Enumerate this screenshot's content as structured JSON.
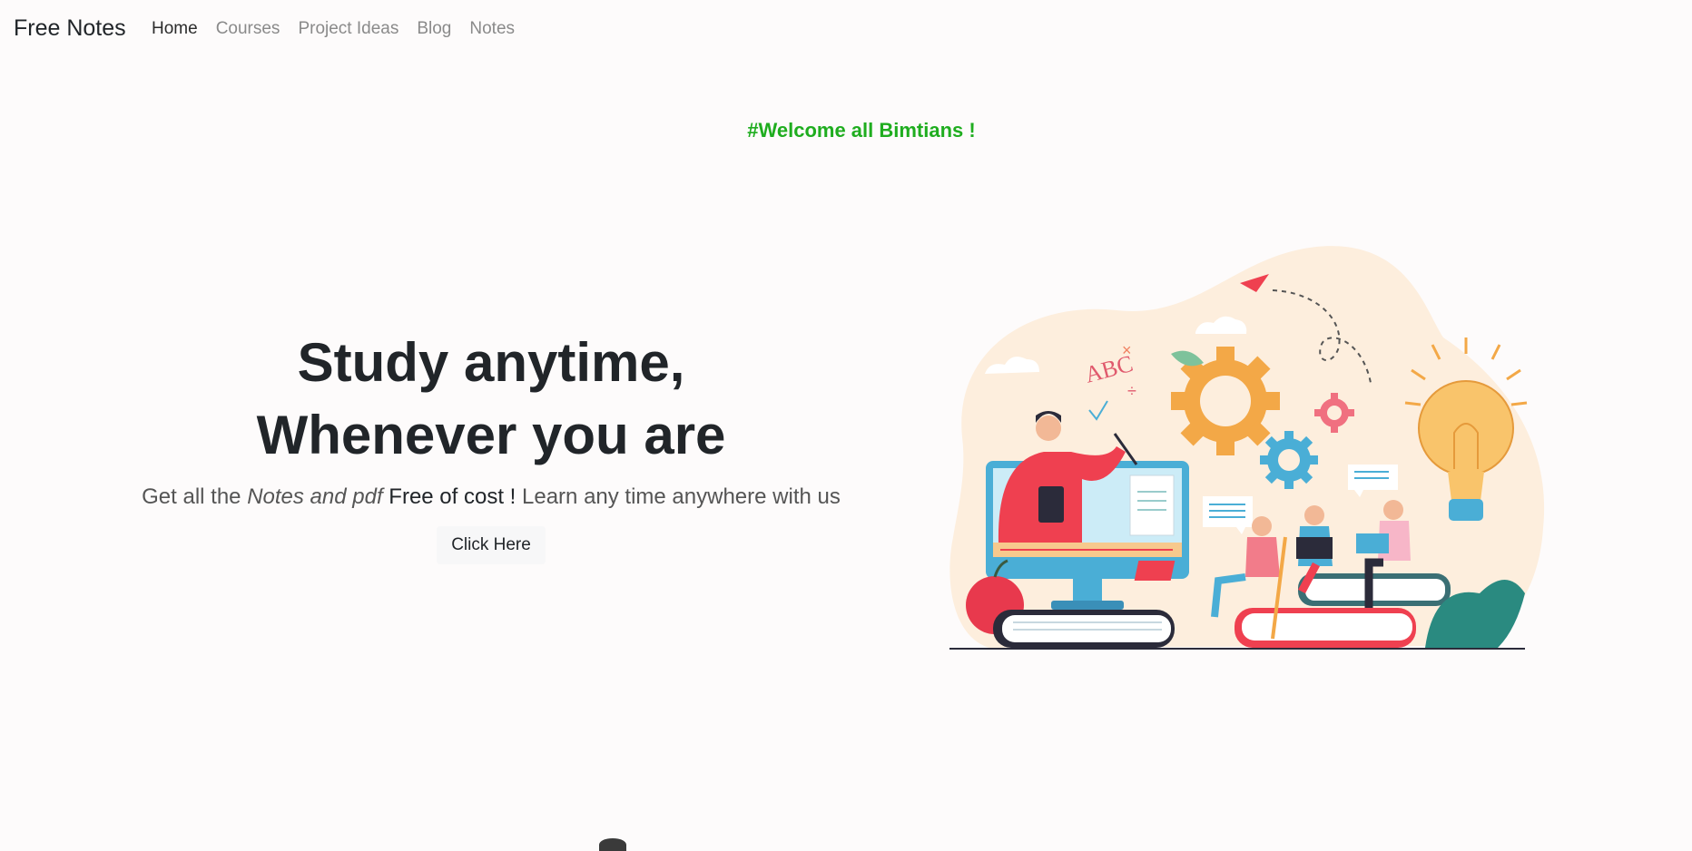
{
  "navbar": {
    "brand": "Free Notes",
    "links": [
      "Home",
      "Courses",
      "Project Ideas",
      "Blog",
      "Notes"
    ],
    "active": "Home"
  },
  "welcome": "#Welcome all Bimtians !",
  "hero": {
    "title_line1": "Study anytime,",
    "title_line2": "Whenever you are",
    "lead_part1": "Get all the ",
    "lead_em": "Notes and pdf",
    "lead_strong": " Free of cost !",
    "lead_part2": " Learn any time anywhere with us",
    "cta_label": "Click Here"
  },
  "illustration": {
    "letters": "ABC",
    "icons": [
      "paper-plane-icon",
      "gear-icon",
      "lightbulb-icon",
      "apple-icon",
      "books-icon",
      "laptop-icon"
    ]
  },
  "colors": {
    "accent_green": "#1fad1f",
    "blob": "#fdeedd",
    "red": "#ef4050",
    "blue": "#4aaed6",
    "orange": "#f3a847"
  }
}
